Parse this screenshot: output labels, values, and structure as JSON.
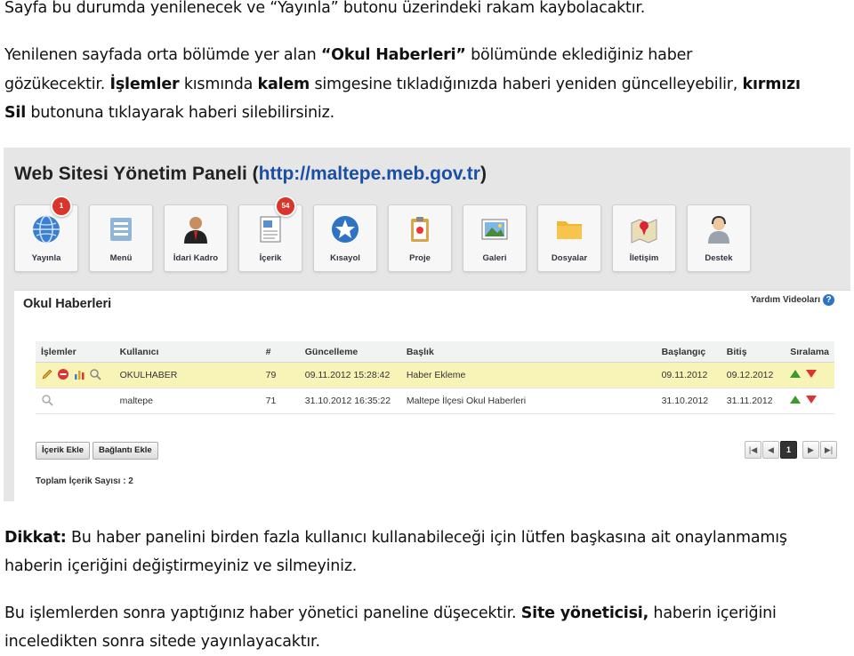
{
  "intro": {
    "line1": "Sayfa bu durumda yenilenecek ve “Yayınla” butonu üzerindeki rakam kaybolacaktır.",
    "line2_a": "Yenilenen sayfada orta bölümde yer alan ",
    "line2_b": "“Okul Haberleri”",
    "line2_c": " bölümünde eklediğiniz haber",
    "line3_a": "gözükecektir. ",
    "line3_b": "İşlemler",
    "line3_c": " kısmında ",
    "line3_d": "kalem",
    "line3_e": " simgesine tıkladığınızda haberi yeniden güncelleyebilir, ",
    "line3_f": "kırmızı",
    "line4_a": "Sil",
    "line4_b": " butonuna tıklayarak haberi silebilirsiniz."
  },
  "panel": {
    "title": "Web Sitesi Yönetim Paneli (",
    "url": "http://maltepe.meb.gov.tr",
    "title_end": ")",
    "tiles": [
      {
        "label": "Yayınla",
        "badge": "1",
        "icon": "globe-icon"
      },
      {
        "label": "Menü",
        "badge": "",
        "icon": "menu-icon"
      },
      {
        "label": "İdari Kadro",
        "badge": "",
        "icon": "person-icon"
      },
      {
        "label": "İçerik",
        "badge": "54",
        "icon": "document-icon"
      },
      {
        "label": "Kısayol",
        "badge": "",
        "icon": "star-icon"
      },
      {
        "label": "Proje",
        "badge": "",
        "icon": "clipboard-icon"
      },
      {
        "label": "Galeri",
        "badge": "",
        "icon": "image-icon"
      },
      {
        "label": "Dosyalar",
        "badge": "",
        "icon": "folder-icon"
      },
      {
        "label": "İletişim",
        "badge": "",
        "icon": "map-pin-icon"
      },
      {
        "label": "Destek",
        "badge": "",
        "icon": "support-icon"
      }
    ],
    "section_title": "Okul Haberleri",
    "help_label": "Yardım Videoları",
    "help_icon": "?",
    "columns": [
      "İşlemler",
      "Kullanıcı",
      "#",
      "Güncelleme",
      "Başlık",
      "Başlangıç",
      "Bitiş",
      "Sıralama"
    ],
    "rows": [
      {
        "user": "OKULHABER",
        "id": "79",
        "updated": "09.11.2012 15:28:42",
        "title": "Haber Ekleme",
        "start": "09.11.2012",
        "end": "09.12.2012"
      },
      {
        "user": "maltepe",
        "id": "71",
        "updated": "31.10.2012 16:35:22",
        "title": "Maltepe İlçesi Okul Haberleri",
        "start": "31.10.2012",
        "end": "31.11.2012"
      }
    ],
    "btn_add_content": "İçerik Ekle",
    "btn_add_link": "Bağlantı Ekle",
    "pager": {
      "first": "|◀",
      "prev": "◀",
      "current": "1",
      "next": "▶",
      "last": "▶|"
    },
    "total": "Toplam İçerik Sayısı : 2"
  },
  "notes": {
    "dikkat_label": "Dikkat:",
    "dikkat_1": " Bu haber panelini birden fazla kullanıcı kullanabileceği için lütfen başkasına ait onaylanmamış",
    "dikkat_2": "haberin içeriğini değiştirmeyiniz ve silmeyiniz.",
    "final_1a": "Bu işlemlerden sonra yaptığınız haber yönetici paneline düşecektir. ",
    "final_1b": "Site yöneticisi,",
    "final_1c": " haberin içeriğini",
    "final_2": "inceledikten sonra sitede yayınlayacaktır."
  },
  "colors": {
    "accent_blue": "#1a4fa3",
    "badge_red": "#d9352b",
    "highlight_row": "#f8f4b8"
  }
}
